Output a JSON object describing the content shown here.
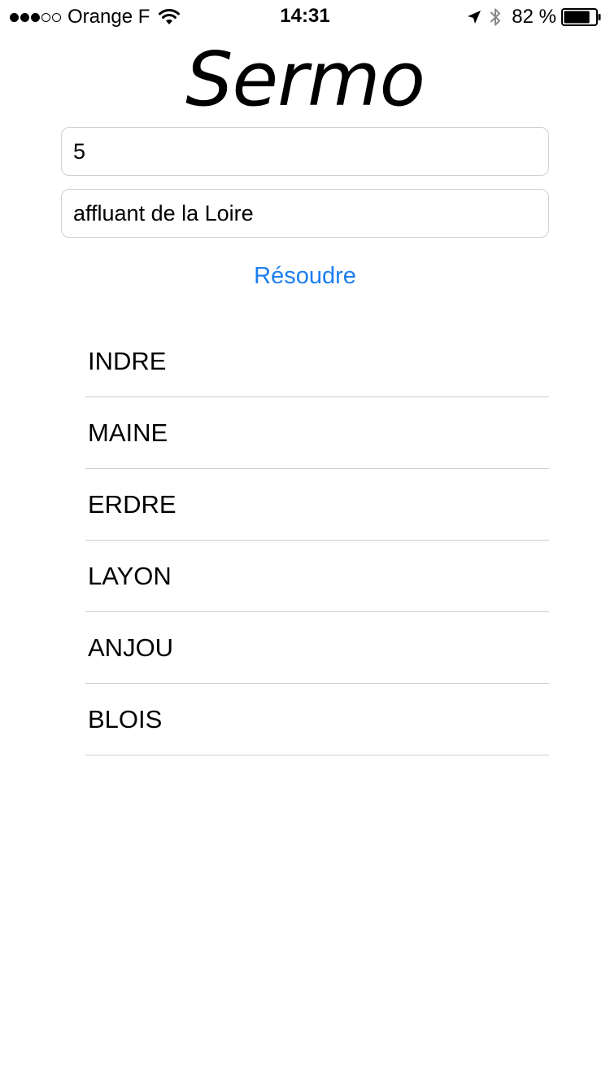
{
  "status_bar": {
    "signal_bars_filled": 3,
    "signal_bars_total": 5,
    "carrier": "Orange F",
    "time": "14:31",
    "battery_percent": "82 %",
    "battery_level": 0.82,
    "icons": [
      "wifi-icon",
      "location-arrow-icon",
      "bluetooth-icon",
      "battery-icon"
    ]
  },
  "app": {
    "title": "Sermo"
  },
  "form": {
    "length_value": "5",
    "definition_value": "affluant de la Loire",
    "solve_label": "Résoudre"
  },
  "results": [
    "INDRE",
    "MAINE",
    "ERDRE",
    "LAYON",
    "ANJOU",
    "BLOIS"
  ],
  "colors": {
    "accent": "#1b7ef2",
    "separator": "#cfcfcf",
    "background": "#ffffff",
    "text": "#000000"
  }
}
